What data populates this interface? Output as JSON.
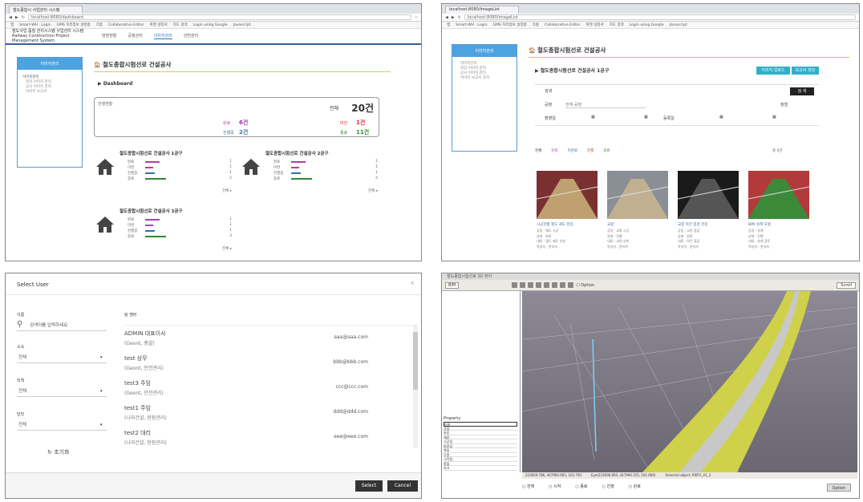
{
  "tl": {
    "tab": "철도종합시 사업관리 시스템",
    "address": "localhost:8080/dashboard",
    "bookmarks": [
      "앱",
      "Smart-WH : Login",
      "GMS 지리정보 설정법",
      "크롬",
      "Collaborative Editor",
      "위젯 설정서",
      "지도 검색",
      "Login using Google",
      "Javascript"
    ],
    "logo_line1": "철도사업 품질 관리시스템 사업관리 시스템",
    "logo_line2": "Railway Construction Project Management System",
    "menu": [
      "현장현황",
      "공정관리",
      "이미지관리",
      "안전관리"
    ],
    "sidebar_head": "이미지관리",
    "sidebar_item": "이미지관리",
    "sidebar_subs": [
      "현장 이미지 관리",
      "공사 이미지 관리",
      "이미지 보고서"
    ],
    "page_title": "철도종합시험선로 건설공사",
    "dashboard": "▶ Dashboard",
    "summary": {
      "label": "진행현황",
      "total_label": "전체",
      "total": "20건",
      "done_label": "완료",
      "done": "6건",
      "fail_label": "미완",
      "fail": "1건",
      "plan_label": "진행중",
      "plan": "2건",
      "prog_label": "종료",
      "prog": "11건"
    },
    "sites": [
      {
        "title": "철도종합시험선로 건설공사 1공구",
        "rows": [
          [
            "완료",
            "1"
          ],
          [
            "미완",
            "1"
          ],
          [
            "진행중",
            "1"
          ],
          [
            "종료",
            "2"
          ]
        ],
        "more": "전체 ▸"
      },
      {
        "title": "철도종합시험선로 건설공사 2공구",
        "rows": [
          [
            "완료",
            "1"
          ],
          [
            "미완",
            "1"
          ],
          [
            "진행중",
            "1"
          ],
          [
            "종료",
            "4"
          ]
        ],
        "more": "전체 ▸"
      },
      {
        "title": "철도종합시험선로 건설공사 3공구",
        "rows": [
          [
            "완료",
            "1"
          ],
          [
            "미완",
            "1"
          ],
          [
            "진행중",
            "1"
          ],
          [
            "종료",
            "3"
          ]
        ],
        "more": "전체 ▸"
      }
    ]
  },
  "tr": {
    "tab": "localhost:8080/imageList",
    "address": "localhost:8080/imageList",
    "sidebar_head": "이미지관리",
    "sidebar_subs": [
      "이미지관리",
      "현장 이미지 관리",
      "공사 이미지 관리",
      "이미지 보고서 관리"
    ],
    "page_title": "철도종합시험선로 건설공사",
    "sub_title": "▶ 철도종합시험선로 건설공사 1공구",
    "btn_upload": "이미지 업로드",
    "btn_report": "보고서 생성",
    "search_label": "검색",
    "search_btn": "검 색",
    "f_kind": "공정",
    "f_kind_val": "전체 공정",
    "f_date": "촬영일",
    "f_reg": "등록일",
    "f_sort": "정렬",
    "filters": [
      "전체",
      "완료",
      "미완료",
      "진행",
      "종료"
    ],
    "count": "총 4건",
    "cards": [
      {
        "title": "시공현황 철도 궤도 현장",
        "meta": [
          "공정 : 궤도 시공",
          "상태 : 완료",
          "내용 : 철도 궤도 부설",
          "작성자 : 관리자"
        ]
      },
      {
        "title": "교량",
        "meta": [
          "공정 : 교량 시공",
          "상태 : 진행",
          "내용 : 교량 상판",
          "작성자 : 관리자"
        ]
      },
      {
        "title": "교량 야간 점검 현장",
        "meta": [
          "공정 : 교량 점검",
          "상태 : 완료",
          "내용 : 야간 점검",
          "작성자 : 관리자"
        ]
      },
      {
        "title": "BIM 설계 모델",
        "meta": [
          "공정 : 설계",
          "상태 : 진행",
          "내용 : 설계 검토",
          "작성자 : 관리자"
        ]
      }
    ]
  },
  "bl": {
    "title": "Select User",
    "name_label": "이름",
    "name_ph": "검색어를 입력하세요",
    "dept_label": "소속",
    "dept_val": "전체",
    "role_label": "직책",
    "role_val": "전체",
    "task_label": "담당",
    "task_val": "전체",
    "reset": "초기화",
    "list_header": "팀 멤버",
    "users": [
      {
        "name": "ADMIN  대표이사",
        "org": "(Geont, 총괄)",
        "email": "aaa@aaa.com"
      },
      {
        "name": "test  상무",
        "org": "(Geont, 안전관리)",
        "email": "bbb@bbb.com"
      },
      {
        "name": "test3  주임",
        "org": "(Geont, 안전관리)",
        "email": "ccc@ccc.com"
      },
      {
        "name": "test1  주임",
        "org": "(나라건설, 현장관리)",
        "email": "ddd@ddd.com"
      },
      {
        "name": "test2  대리",
        "org": "(나라건설, 현장관리)",
        "email": "eee@eee.com"
      }
    ],
    "select_btn": "Select",
    "cancel_btn": "Cancel"
  },
  "br": {
    "title": "철도종합시험선로 3D 뷰어",
    "tree_root": "BIM",
    "option_label": "Option",
    "zoom": "Scroll",
    "props_title": "Property",
    "props": [
      "이름",
      "공정",
      "분류",
      "재료",
      "시공일",
      "완료일",
      "측점",
      "단면",
      "시작점",
      "종점",
      "비고"
    ],
    "status_coord": "223009.786, 447992.665, 102.750",
    "status_eye": "Eye(223006.850, 447990.355, 101.660)",
    "status_sel": "Selected object: PIER1_A1_2",
    "bottom": [
      "전체",
      "시작",
      "종료",
      "진행",
      "완료"
    ],
    "bottom_btn": "Option"
  }
}
